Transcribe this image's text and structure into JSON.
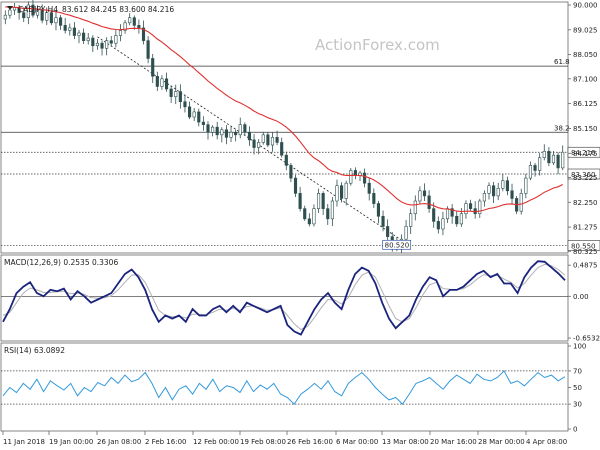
{
  "header": {
    "symbol": "CADJPY,H4",
    "ohlc": "83.612 84.245 83.600 84.216",
    "watermark": "ActionForex.com"
  },
  "colors": {
    "candles": "#2f4f4f",
    "ma": "#e03030",
    "macd": "#1a237e",
    "macd_signal": "#b0b0b0",
    "rsi": "#3399dd",
    "hline": "#333333"
  },
  "chart_data": [
    {
      "type": "candlestick",
      "title": "CADJPY,H4",
      "ylim": [
        80.375,
        90.0
      ],
      "y_ticks": [
        "90.000",
        "89.025",
        "88.050",
        "87.100",
        "86.125",
        "85.150",
        "84.175",
        "83.225",
        "82.250",
        "81.275",
        "80.325"
      ],
      "x_ticks": [
        "11 Jan 2018",
        "19 Jan 00:00",
        "26 Jan 08:00",
        "2 Feb 16:00",
        "12 Feb 00:00",
        "19 Feb 08:00",
        "26 Feb 16:00",
        "6 Mar 00:00",
        "13 Mar 08:00",
        "20 Mar 16:00",
        "28 Mar 00:00",
        "4 Apr 08:00"
      ],
      "closes": [
        89.6,
        89.8,
        89.9,
        89.7,
        89.5,
        90.0,
        89.6,
        89.8,
        89.4,
        89.7,
        89.3,
        89.5,
        89.2,
        89.0,
        89.1,
        88.8,
        88.9,
        88.6,
        88.7,
        88.4,
        88.5,
        88.3,
        88.6,
        88.5,
        88.8,
        89.0,
        89.3,
        89.5,
        89.2,
        89.1,
        88.6,
        87.9,
        87.2,
        86.8,
        87.1,
        86.7,
        86.4,
        86.6,
        86.2,
        86.0,
        85.6,
        85.8,
        85.4,
        85.3,
        85.0,
        85.2,
        84.9,
        85.1,
        84.8,
        85.0,
        84.9,
        85.3,
        85.0,
        84.7,
        84.4,
        84.6,
        84.9,
        84.5,
        84.8,
        84.6,
        84.1,
        83.7,
        83.2,
        82.6,
        82.0,
        81.6,
        81.4,
        82.0,
        82.6,
        82.0,
        81.6,
        82.3,
        82.9,
        82.4,
        83.0,
        83.5,
        83.3,
        83.4,
        83.0,
        82.6,
        82.2,
        81.7,
        81.3,
        80.9,
        80.6,
        80.5,
        80.8,
        81.3,
        81.8,
        82.3,
        82.7,
        82.5,
        82.0,
        81.5,
        81.2,
        81.6,
        82.0,
        81.7,
        81.4,
        81.8,
        82.2,
        82.0,
        81.8,
        82.3,
        82.6,
        82.9,
        82.5,
        82.8,
        83.1,
        82.7,
        82.4,
        81.9,
        82.6,
        83.2,
        83.7,
        83.5,
        84.0,
        84.25,
        83.8,
        84.1,
        83.6,
        84.216
      ],
      "ma_start": 89.95,
      "ma_end": 82.95,
      "horizontal_lines": [
        {
          "price": 87.6,
          "label": "61.8",
          "style": "solid"
        },
        {
          "price": 85.0,
          "label": "38.2",
          "style": "solid"
        },
        {
          "price": 84.216,
          "label": "84.216",
          "style": "dotted",
          "box": true
        },
        {
          "price": 83.36,
          "label": "83.360",
          "style": "dotted",
          "box": true
        },
        {
          "price": 80.55,
          "label": "80.550",
          "style": "dotted",
          "box": true
        }
      ],
      "trendline": {
        "from_price": 88.75,
        "to_price": 80.52,
        "from_index": 20,
        "to_index": 88
      },
      "low_label": {
        "text": "80.520",
        "price": 80.52,
        "index": 88
      }
    },
    {
      "type": "line",
      "title": "MACD(12,26,9) 0.2535 0.3306",
      "ylim": [
        -0.6532,
        0.6
      ],
      "y_ticks": [
        "0.4875",
        "0.00",
        "-0.6532"
      ],
      "zero_label": "0.00",
      "macd_values": [
        -0.4,
        -0.2,
        0.05,
        0.15,
        0.22,
        0.05,
        0.0,
        0.1,
        0.08,
        0.12,
        -0.05,
        0.08,
        0.0,
        -0.1,
        -0.05,
        0.0,
        0.05,
        0.2,
        0.35,
        0.42,
        0.3,
        0.1,
        -0.2,
        -0.4,
        -0.3,
        -0.35,
        -0.3,
        -0.4,
        -0.2,
        -0.3,
        -0.3,
        -0.2,
        -0.15,
        -0.25,
        -0.15,
        -0.25,
        -0.1,
        -0.15,
        -0.2,
        -0.25,
        -0.2,
        -0.15,
        -0.45,
        -0.55,
        -0.6,
        -0.4,
        -0.2,
        -0.05,
        0.05,
        -0.1,
        -0.2,
        0.1,
        0.35,
        0.45,
        0.4,
        0.2,
        -0.1,
        -0.35,
        -0.5,
        -0.4,
        -0.3,
        -0.05,
        0.15,
        0.3,
        0.25,
        0.0,
        0.1,
        0.1,
        0.15,
        0.25,
        0.35,
        0.4,
        0.3,
        0.35,
        0.2,
        0.2,
        0.05,
        0.3,
        0.45,
        0.55,
        0.54,
        0.45,
        0.36,
        0.25
      ],
      "signal_values": [
        -0.3,
        -0.25,
        -0.1,
        0.05,
        0.13,
        0.1,
        0.06,
        0.06,
        0.07,
        0.08,
        0.04,
        0.05,
        0.03,
        -0.02,
        -0.03,
        -0.02,
        0.01,
        0.1,
        0.22,
        0.33,
        0.34,
        0.22,
        0.0,
        -0.22,
        -0.3,
        -0.32,
        -0.31,
        -0.34,
        -0.28,
        -0.28,
        -0.29,
        -0.25,
        -0.2,
        -0.22,
        -0.19,
        -0.22,
        -0.16,
        -0.15,
        -0.18,
        -0.22,
        -0.21,
        -0.18,
        -0.3,
        -0.43,
        -0.52,
        -0.47,
        -0.33,
        -0.18,
        -0.05,
        -0.06,
        -0.12,
        -0.02,
        0.18,
        0.33,
        0.38,
        0.3,
        0.08,
        -0.15,
        -0.35,
        -0.4,
        -0.35,
        -0.18,
        0.02,
        0.18,
        0.22,
        0.12,
        0.11,
        0.1,
        0.12,
        0.18,
        0.27,
        0.34,
        0.32,
        0.33,
        0.27,
        0.22,
        0.13,
        0.2,
        0.33,
        0.45,
        0.5,
        0.48,
        0.42,
        0.33
      ]
    },
    {
      "type": "line",
      "title": "RSI(14) 63.0892",
      "ylim": [
        0,
        100
      ],
      "y_ticks": [
        "100",
        "70",
        "50",
        "30",
        "0"
      ],
      "levels": [
        70,
        30
      ],
      "rsi_values": [
        40,
        50,
        44,
        55,
        48,
        60,
        45,
        58,
        52,
        47,
        55,
        40,
        50,
        45,
        56,
        52,
        62,
        55,
        65,
        57,
        60,
        68,
        55,
        38,
        50,
        35,
        48,
        52,
        42,
        55,
        48,
        60,
        45,
        52,
        50,
        44,
        58,
        45,
        53,
        48,
        55,
        42,
        38,
        30,
        42,
        48,
        55,
        48,
        58,
        45,
        40,
        55,
        62,
        68,
        60,
        50,
        42,
        35,
        38,
        30,
        42,
        55,
        58,
        62,
        55,
        48,
        58,
        65,
        60,
        55,
        66,
        60,
        58,
        62,
        70,
        55,
        58,
        52,
        60,
        68,
        62,
        65,
        58,
        63
      ]
    }
  ]
}
